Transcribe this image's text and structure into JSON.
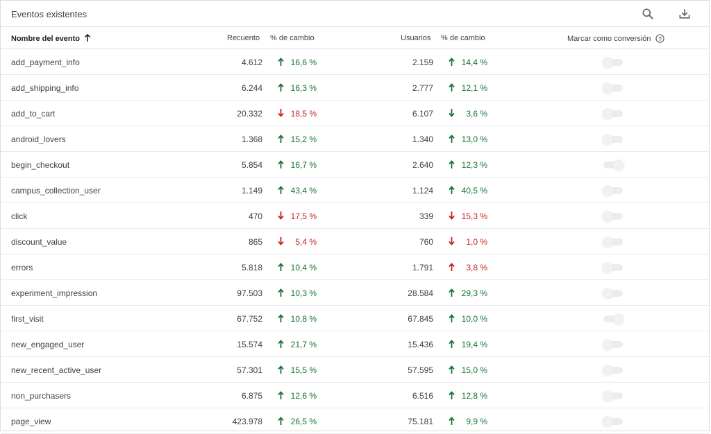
{
  "header": {
    "title": "Eventos existentes"
  },
  "columns": {
    "event_name": "Nombre del evento",
    "count": "Recuento",
    "count_change": "% de cambio",
    "users": "Usuarios",
    "users_change": "% de cambio",
    "conversion": "Marcar como conversión"
  },
  "icons": {
    "search": "search-icon",
    "download": "download-icon",
    "sort": "arrow-up-icon",
    "help": "help-icon"
  },
  "colors": {
    "up": "#137333",
    "down": "#c5221f"
  },
  "rows": [
    {
      "name": "add_payment_info",
      "count": "4.612",
      "count_change": "16,6 %",
      "count_dir": "up",
      "users": "2.159",
      "users_change": "14,4 %",
      "users_dir": "up",
      "conversion": false
    },
    {
      "name": "add_shipping_info",
      "count": "6.244",
      "count_change": "16,3 %",
      "count_dir": "up",
      "users": "2.777",
      "users_change": "12,1 %",
      "users_dir": "up",
      "conversion": false
    },
    {
      "name": "add_to_cart",
      "count": "20.332",
      "count_change": "18,5 %",
      "count_dir": "down",
      "users": "6.107",
      "users_change": "3,6 %",
      "users_dir": "down_good",
      "conversion": false
    },
    {
      "name": "android_lovers",
      "count": "1.368",
      "count_change": "15,2 %",
      "count_dir": "up",
      "users": "1.340",
      "users_change": "13,0 %",
      "users_dir": "up",
      "conversion": false
    },
    {
      "name": "begin_checkout",
      "count": "5.854",
      "count_change": "16,7 %",
      "count_dir": "up",
      "users": "2.640",
      "users_change": "12,3 %",
      "users_dir": "up",
      "conversion": true
    },
    {
      "name": "campus_collection_user",
      "count": "1.149",
      "count_change": "43,4 %",
      "count_dir": "up",
      "users": "1.124",
      "users_change": "40,5 %",
      "users_dir": "up",
      "conversion": false
    },
    {
      "name": "click",
      "count": "470",
      "count_change": "17,5 %",
      "count_dir": "down",
      "users": "339",
      "users_change": "15,3 %",
      "users_dir": "down",
      "conversion": false
    },
    {
      "name": "discount_value",
      "count": "865",
      "count_change": "5,4 %",
      "count_dir": "down",
      "users": "760",
      "users_change": "1,0 %",
      "users_dir": "down",
      "conversion": false
    },
    {
      "name": "errors",
      "count": "5.818",
      "count_change": "10,4 %",
      "count_dir": "up",
      "users": "1.791",
      "users_change": "3,8 %",
      "users_dir": "up_bad",
      "conversion": false
    },
    {
      "name": "experiment_impression",
      "count": "97.503",
      "count_change": "10,3 %",
      "count_dir": "up",
      "users": "28.584",
      "users_change": "29,3 %",
      "users_dir": "up",
      "conversion": false
    },
    {
      "name": "first_visit",
      "count": "67.752",
      "count_change": "10,8 %",
      "count_dir": "up",
      "users": "67.845",
      "users_change": "10,0 %",
      "users_dir": "up",
      "conversion": true
    },
    {
      "name": "new_engaged_user",
      "count": "15.574",
      "count_change": "21,7 %",
      "count_dir": "up",
      "users": "15.436",
      "users_change": "19,4 %",
      "users_dir": "up",
      "conversion": false
    },
    {
      "name": "new_recent_active_user",
      "count": "57.301",
      "count_change": "15,5 %",
      "count_dir": "up",
      "users": "57.595",
      "users_change": "15,0 %",
      "users_dir": "up",
      "conversion": false
    },
    {
      "name": "non_purchasers",
      "count": "6.875",
      "count_change": "12,6 %",
      "count_dir": "up",
      "users": "6.516",
      "users_change": "12,8 %",
      "users_dir": "up",
      "conversion": false
    },
    {
      "name": "page_view",
      "count": "423.978",
      "count_change": "26,5 %",
      "count_dir": "up",
      "users": "75.181",
      "users_change": "9,9 %",
      "users_dir": "up",
      "conversion": false
    }
  ]
}
